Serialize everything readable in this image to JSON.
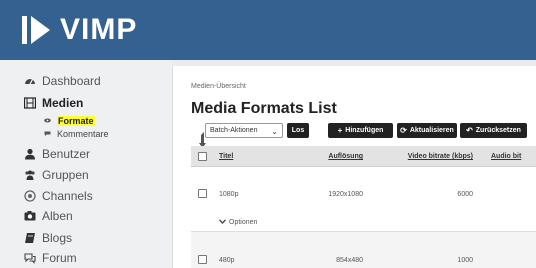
{
  "header": {
    "logo_text": "VIMP",
    "color": "#34618f"
  },
  "sidebar": {
    "items": [
      {
        "label": "Dashboard",
        "icon": "dashboard-icon"
      },
      {
        "label": "Medien",
        "icon": "film-icon",
        "active": true
      },
      {
        "label": "Benutzer",
        "icon": "user-icon"
      },
      {
        "label": "Gruppen",
        "icon": "users-icon"
      },
      {
        "label": "Channels",
        "icon": "channel-icon"
      },
      {
        "label": "Alben",
        "icon": "camera-icon"
      },
      {
        "label": "Blogs",
        "icon": "book-icon"
      },
      {
        "label": "Forum",
        "icon": "chat-icon"
      }
    ],
    "sub_items": [
      {
        "label": "Formate",
        "icon": "eye-icon",
        "highlighted": true
      },
      {
        "label": "Kommentare",
        "icon": "comment-icon"
      }
    ]
  },
  "main": {
    "breadcrumb": "Medien-Übersicht",
    "title": "Media Formats List",
    "batch_select": {
      "value": "Batch-Aktionen"
    },
    "buttons": {
      "go": "Los",
      "add": "Hinzufügen",
      "refresh": "Aktualisieren",
      "reset": "Zurücksetzen"
    },
    "table": {
      "headers": [
        "Titel",
        "Auflösung",
        "Video bitrate (kbps)",
        "Audio bit"
      ],
      "rows": [
        {
          "title": "1080p",
          "resolution": "1920x1080",
          "video_bitrate": "6000",
          "options": "Optionen"
        },
        {
          "title": "480p",
          "resolution": "854x480",
          "video_bitrate": "1000"
        }
      ]
    }
  }
}
